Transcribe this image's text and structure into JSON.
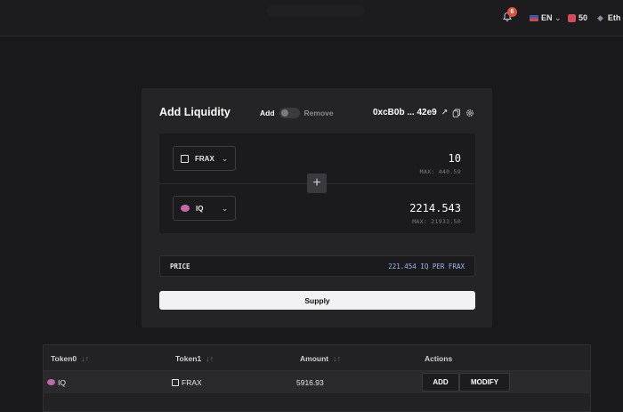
{
  "topbar": {
    "notification_count": "6",
    "language": "EN",
    "balance": "50",
    "network": "Eth"
  },
  "liquidity": {
    "title": "Add Liquidity",
    "toggle_add": "Add",
    "toggle_remove": "Remove",
    "address": "0xcB0b ... 42e9",
    "token0": {
      "symbol": "FRAX",
      "amount": "10",
      "max": "MAX: 440.59"
    },
    "token1": {
      "symbol": "IQ",
      "amount": "2214.543",
      "max": "MAX: 21933.50"
    },
    "price_label": "PRICE",
    "price_value": "221.454 IQ PER FRAX",
    "supply_label": "Supply"
  },
  "table": {
    "headers": [
      "Token0",
      "Token1",
      "Amount",
      "Actions"
    ],
    "rows": [
      {
        "token0": "IQ",
        "token1": "FRAX",
        "amount": "5916.93",
        "add_label": "ADD",
        "modify_label": "MODIFY"
      }
    ]
  },
  "icons": {
    "notification": "bell-icon",
    "language": "flag-icon",
    "balance": "token-icon",
    "network": "ethereum-icon",
    "external": "external-link-icon",
    "copy": "copy-icon",
    "settings": "gear-icon",
    "plus": "plus-icon",
    "sort": "sort-icon"
  },
  "colors": {
    "background": "#19191b",
    "card": "#242426",
    "accent_price": "#9eb8ec",
    "badge": "#e0513e",
    "iq_token": "#c16aa8"
  }
}
